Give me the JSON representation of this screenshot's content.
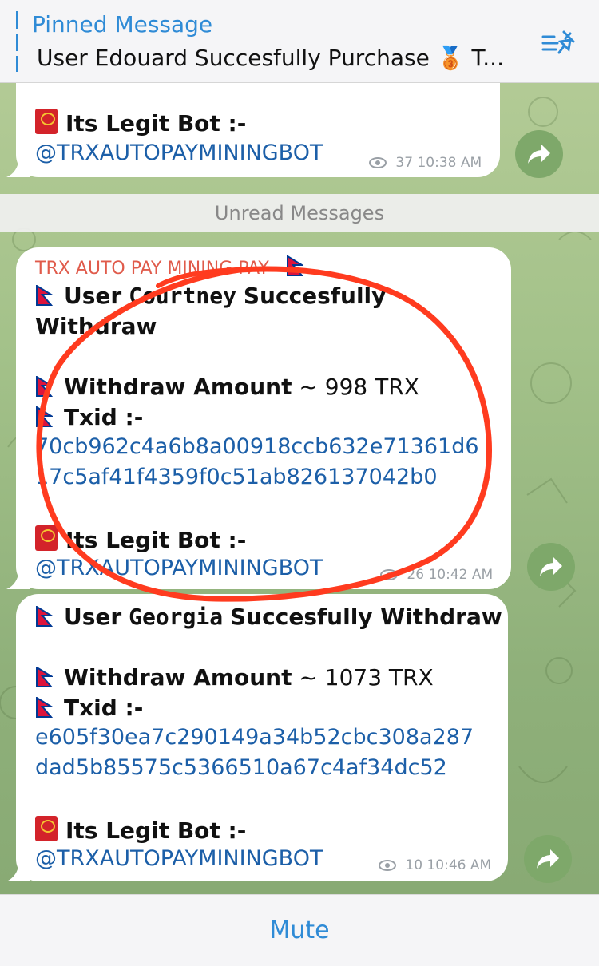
{
  "pinned": {
    "title": "Pinned Message",
    "text": "User Edouard Succesfully Purchase 🥉 T..."
  },
  "top_bubble": {
    "bot_label": "Its Legit Bot :-",
    "bot_link": "@TRXAUTOPAYMININGBOT",
    "views": "37",
    "time": "10:38 AM"
  },
  "unread_divider": "Unread Messages",
  "message1": {
    "sender": "TRX AUTO PAY MINING PAY",
    "user_prefix": "User",
    "user_name": "Courtney",
    "user_suffix": "Succesfully",
    "line2": "Withdraw",
    "amount_label": "Withdraw Amount",
    "amount_value": "~ 998 TRX",
    "txid_label": "Txid :-",
    "txid_line1": "70cb962c4a6b8a00918ccb632e71361d6",
    "txid_line2": "17c5af41f4359f0c51ab826137042b0",
    "bot_label": "Its Legit Bot :-",
    "bot_link": "@TRXAUTOPAYMININGBOT",
    "views": "26",
    "time": "10:42 AM"
  },
  "message2": {
    "user_prefix": "User",
    "user_name": "Georgia",
    "user_suffix": "Succesfully Withdraw",
    "amount_label": "Withdraw Amount",
    "amount_value": "~ 1073 TRX",
    "txid_label": "Txid :-",
    "txid_line1": "e605f30ea7c290149a34b52cbc308a287",
    "txid_line2": "dad5b85575c5366510a67c4af34dc52",
    "bot_label": "Its Legit Bot :-",
    "bot_link": "@TRXAUTOPAYMININGBOT",
    "views": "10",
    "time": "10:46 AM"
  },
  "bottom": {
    "mute_label": "Mute"
  },
  "icons": [
    "pin-list-icon",
    "eye-icon",
    "forward-icon",
    "red-envelope-icon",
    "nepal-flag-icon"
  ],
  "colors": {
    "accent": "#2f8bd6",
    "link": "#1c5fa8",
    "sender": "#e05b4b",
    "annotation": "#ff3b1f"
  }
}
